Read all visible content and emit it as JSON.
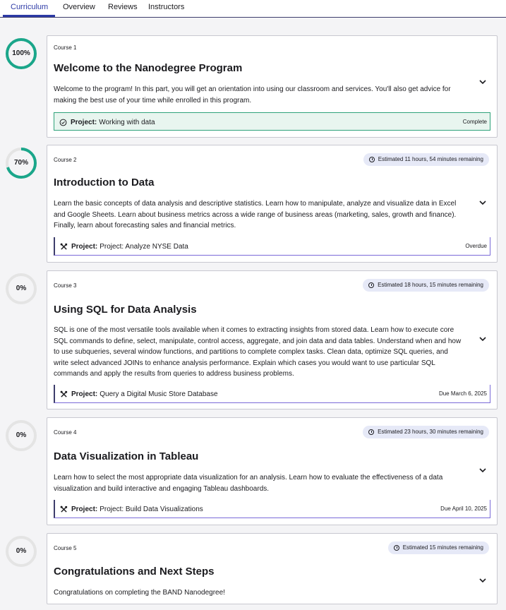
{
  "tabs": [
    {
      "label": "Curriculum",
      "active": true
    },
    {
      "label": "Overview"
    },
    {
      "label": "Reviews"
    },
    {
      "label": "Instructors"
    }
  ],
  "colors": {
    "accent": "#2d3aa6",
    "progress_complete": "#1aa68a",
    "ring_track": "#e4e4e4",
    "complete_bg": "#e8f5ef",
    "badge_bg": "#e6e9f7"
  },
  "courses": [
    {
      "progress_label": "100%",
      "progress": 1.0,
      "number": "Course 1",
      "badge": "",
      "title": "Welcome to the Nanodegree Program",
      "description": "Welcome to the program! In this part, you will get an orientation into using our classroom and services. You'll also get advice for making the best use of your time while enrolled in this program.",
      "project_prefix": "Project:",
      "project_name": "Working with data",
      "project_icon": "check-circle-icon",
      "project_status": "Complete"
    },
    {
      "progress_label": "70%",
      "progress": 0.7,
      "number": "Course 2",
      "badge": "Estimated 11 hours, 54 minutes remaining",
      "title": "Introduction to Data",
      "description": "Learn the basic concepts of data analysis and descriptive statistics. Learn how to manipulate, analyze and visualize data in Excel and Google Sheets. Learn about business metrics across a wide range of business areas (marketing, sales, growth and finance). Finally, learn about forecasting sales and financial metrics.",
      "project_prefix": "Project:",
      "project_name": "Project: Analyze NYSE Data",
      "project_icon": "tools-icon",
      "project_status": "Overdue"
    },
    {
      "progress_label": "0%",
      "progress": 0,
      "number": "Course 3",
      "badge": "Estimated 18 hours, 15 minutes remaining",
      "title": "Using SQL for Data Analysis",
      "description": "SQL is one of the most versatile tools available when it comes to extracting insights from stored data. Learn how to execute core SQL commands to define, select, manipulate, control access, aggregate, and join data and data tables. Understand when and how to use subqueries, several window functions, and partitions to complete complex tasks. Clean data, optimize SQL queries, and write select advanced JOINs to enhance analysis performance. Explain which cases you would want to use particular SQL commands and apply the results from queries to address business problems.",
      "project_prefix": "Project:",
      "project_name": "Query a Digital Music Store Database",
      "project_icon": "tools-icon",
      "project_status": "Due March 6, 2025"
    },
    {
      "progress_label": "0%",
      "progress": 0,
      "number": "Course 4",
      "badge": "Estimated 23 hours, 30 minutes remaining",
      "title": "Data Visualization in Tableau",
      "description": "Learn how to select the most appropriate data visualization for an analysis. Learn how to evaluate the effectiveness of a data visualization and build interactive and engaging Tableau dashboards.",
      "project_prefix": "Project:",
      "project_name": "Project: Build Data Visualizations",
      "project_icon": "tools-icon",
      "project_status": "Due April 10, 2025"
    },
    {
      "progress_label": "0%",
      "progress": 0,
      "number": "Course 5",
      "badge": "Estimated 15 minutes remaining",
      "title": "Congratulations and Next Steps",
      "description": "Congratulations on completing the BAND Nanodegree!"
    }
  ]
}
